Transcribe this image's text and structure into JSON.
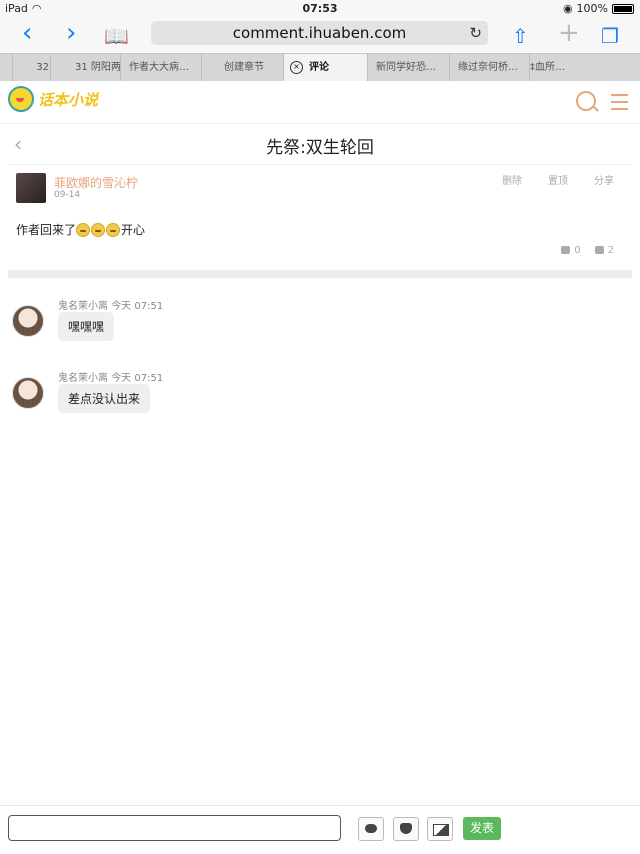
{
  "status": {
    "device": "iPad",
    "time": "07:53",
    "battery": "100%"
  },
  "browser": {
    "url": "comment.ihuaben.com",
    "tabs": [
      "32",
      "31 阴阳两",
      "作者大大病…",
      "创建章节",
      "评论",
      "新同学好恐…",
      "缘过奈何桥…",
      "‡血所…"
    ]
  },
  "site": {
    "logo_text": "话本小说"
  },
  "page": {
    "title": "先祭:双生轮回"
  },
  "post": {
    "author": "菲欧娜的雪沁柠",
    "date": "09-14",
    "actions": [
      "删除",
      "置顶",
      "分享"
    ],
    "content_before": "作者回来了",
    "content_after": "开心",
    "likes": "0",
    "comments": "2"
  },
  "replies": [
    {
      "user": "鬼名茉小离",
      "time": "今天 07:51",
      "text": "嘿嘿嘿"
    },
    {
      "user": "鬼名茉小离",
      "time": "今天 07:51",
      "text": "差点没认出来"
    }
  ],
  "composer": {
    "send_label": "发表"
  }
}
